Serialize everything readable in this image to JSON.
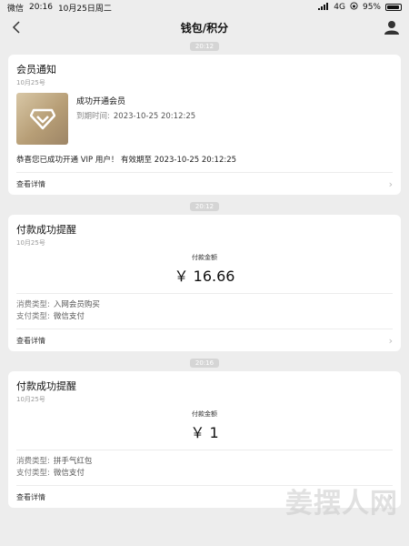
{
  "status": {
    "carrier": "微信",
    "time": "20:16",
    "date": "10月25日周二",
    "network": "4G",
    "battery": "95%"
  },
  "nav": {
    "title": "钱包/积分"
  },
  "cards": [
    {
      "time_chip": "20:12",
      "title": "会员通知",
      "date": "10月25号",
      "member_name": "成功开通会员",
      "expire_label": "到期时间:",
      "expire_value": "2023-10-25 20:12:25",
      "congrats": "恭喜您已成功开通 VIP 用户！ 有效期至 2023-10-25 20:12:25",
      "detail": "查看详情"
    },
    {
      "time_chip": "20:12",
      "title": "付款成功提醒",
      "date": "10月25号",
      "amount_label": "付款金额",
      "amount": "￥ 16.66",
      "consume_label": "消费类型:",
      "consume_value": "入网会员购买",
      "pay_label": "支付类型:",
      "pay_value": "微信支付",
      "detail": "查看详情"
    },
    {
      "time_chip": "20:16",
      "title": "付款成功提醒",
      "date": "10月25号",
      "amount_label": "付款金额",
      "amount": "￥ 1",
      "consume_label": "消费类型:",
      "consume_value": "拼手气红包",
      "pay_label": "支付类型:",
      "pay_value": "微信支付",
      "detail": "查看详情"
    }
  ],
  "watermark": "姜摆人网"
}
